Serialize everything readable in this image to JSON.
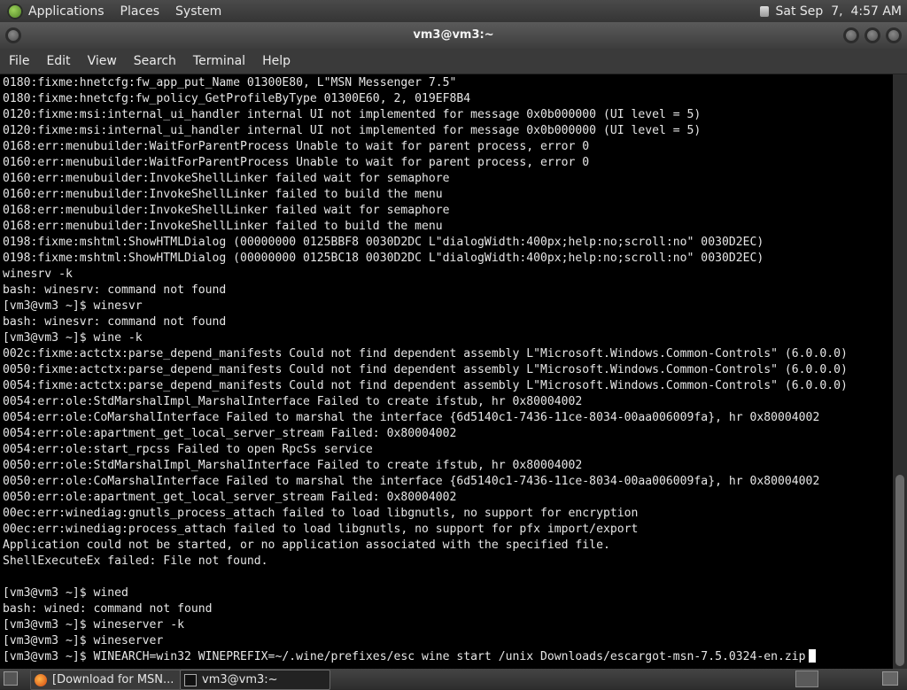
{
  "top_panel": {
    "menus": [
      "Applications",
      "Places",
      "System"
    ],
    "clock": "Sat Sep  7,  4:57 AM"
  },
  "window": {
    "title": "vm3@vm3:~"
  },
  "menubar": {
    "items": [
      "File",
      "Edit",
      "View",
      "Search",
      "Terminal",
      "Help"
    ]
  },
  "terminal": {
    "lines": [
      "0180:fixme:hnetcfg:fw_app_put_Name 01300E80, L\"MSN Messenger 7.5\"",
      "0180:fixme:hnetcfg:fw_policy_GetProfileByType 01300E60, 2, 019EF8B4",
      "0120:fixme:msi:internal_ui_handler internal UI not implemented for message 0x0b000000 (UI level = 5)",
      "0120:fixme:msi:internal_ui_handler internal UI not implemented for message 0x0b000000 (UI level = 5)",
      "0168:err:menubuilder:WaitForParentProcess Unable to wait for parent process, error 0",
      "0160:err:menubuilder:WaitForParentProcess Unable to wait for parent process, error 0",
      "0160:err:menubuilder:InvokeShellLinker failed wait for semaphore",
      "0160:err:menubuilder:InvokeShellLinker failed to build the menu",
      "0168:err:menubuilder:InvokeShellLinker failed wait for semaphore",
      "0168:err:menubuilder:InvokeShellLinker failed to build the menu",
      "0198:fixme:mshtml:ShowHTMLDialog (00000000 0125BBF8 0030D2DC L\"dialogWidth:400px;help:no;scroll:no\" 0030D2EC)",
      "0198:fixme:mshtml:ShowHTMLDialog (00000000 0125BC18 0030D2DC L\"dialogWidth:400px;help:no;scroll:no\" 0030D2EC)",
      "winesrv -k",
      "bash: winesrv: command not found",
      "[vm3@vm3 ~]$ winesvr",
      "bash: winesvr: command not found",
      "[vm3@vm3 ~]$ wine -k",
      "002c:fixme:actctx:parse_depend_manifests Could not find dependent assembly L\"Microsoft.Windows.Common-Controls\" (6.0.0.0)",
      "0050:fixme:actctx:parse_depend_manifests Could not find dependent assembly L\"Microsoft.Windows.Common-Controls\" (6.0.0.0)",
      "0054:fixme:actctx:parse_depend_manifests Could not find dependent assembly L\"Microsoft.Windows.Common-Controls\" (6.0.0.0)",
      "0054:err:ole:StdMarshalImpl_MarshalInterface Failed to create ifstub, hr 0x80004002",
      "0054:err:ole:CoMarshalInterface Failed to marshal the interface {6d5140c1-7436-11ce-8034-00aa006009fa}, hr 0x80004002",
      "0054:err:ole:apartment_get_local_server_stream Failed: 0x80004002",
      "0054:err:ole:start_rpcss Failed to open RpcSs service",
      "0050:err:ole:StdMarshalImpl_MarshalInterface Failed to create ifstub, hr 0x80004002",
      "0050:err:ole:CoMarshalInterface Failed to marshal the interface {6d5140c1-7436-11ce-8034-00aa006009fa}, hr 0x80004002",
      "0050:err:ole:apartment_get_local_server_stream Failed: 0x80004002",
      "00ec:err:winediag:gnutls_process_attach failed to load libgnutls, no support for encryption",
      "00ec:err:winediag:process_attach failed to load libgnutls, no support for pfx import/export",
      "Application could not be started, or no application associated with the specified file.",
      "ShellExecuteEx failed: File not found.",
      "",
      "[vm3@vm3 ~]$ wined",
      "bash: wined: command not found",
      "[vm3@vm3 ~]$ wineserver -k",
      "[vm3@vm3 ~]$ wineserver",
      "[vm3@vm3 ~]$ WINEARCH=win32 WINEPREFIX=~/.wine/prefixes/esc wine start /unix Downloads/escargot-msn-7.5.0324-en.zip"
    ]
  },
  "taskbar": {
    "tasks": [
      "[Download for MSN...",
      "vm3@vm3:~"
    ]
  }
}
